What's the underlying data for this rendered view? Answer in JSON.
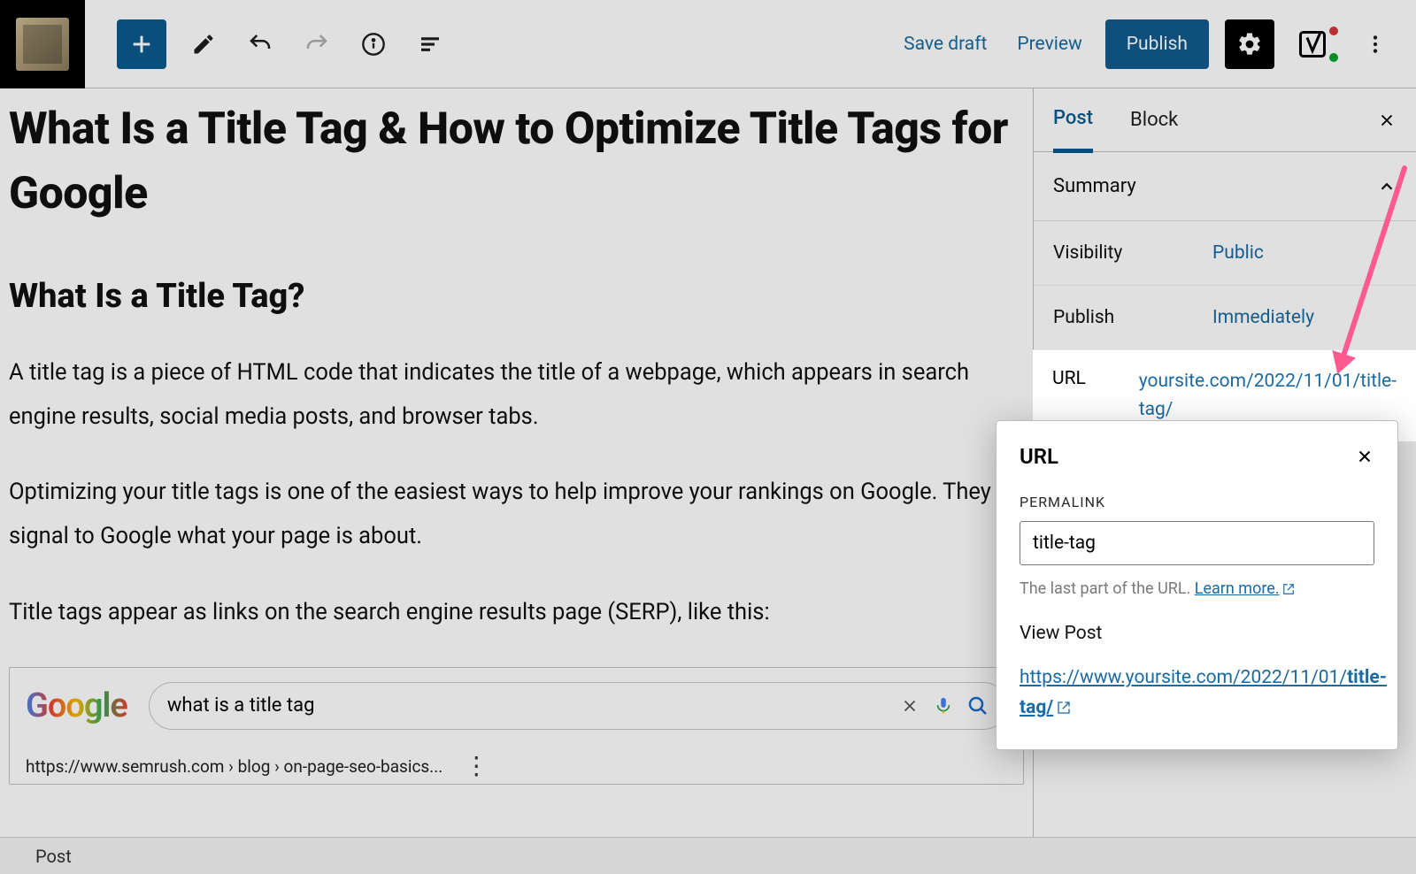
{
  "toolbar": {
    "save_draft": "Save draft",
    "preview": "Preview",
    "publish": "Publish"
  },
  "sidebar": {
    "tabs": {
      "post": "Post",
      "block": "Block"
    },
    "summary_label": "Summary",
    "visibility_label": "Visibility",
    "visibility_value": "Public",
    "publish_label": "Publish",
    "publish_value": "Immediately",
    "url_label": "URL",
    "url_value": "yoursite.com/2022/11/01/title-tag/"
  },
  "popover": {
    "heading": "URL",
    "permalink_label": "PERMALINK",
    "permalink_value": "title-tag",
    "help_text": "The last part of the URL. ",
    "learn_more": "Learn more.",
    "view_post_label": "View Post",
    "full_url_prefix": "https://www.yoursite.com/2022/11/01/",
    "full_url_slug": "title-tag/"
  },
  "editor": {
    "title": "What Is a Title Tag & How to Optimize Title Tags for Google",
    "h2": "What Is a Title Tag?",
    "p1": "A title tag is a piece of HTML code that indicates the title of a webpage, which appears in search engine results, social media posts, and browser tabs.",
    "p2": "Optimizing your title tags is one of the easiest ways to help improve your rankings on Google. They signal to Google what your page is about.",
    "p3": "Title tags appear as links on the search engine results page (SERP), like this:"
  },
  "serp": {
    "logo": "Google",
    "query": "what is a title tag",
    "result_url": "https://www.semrush.com › blog › on-page-seo-basics..."
  },
  "breadcrumb": "Post"
}
